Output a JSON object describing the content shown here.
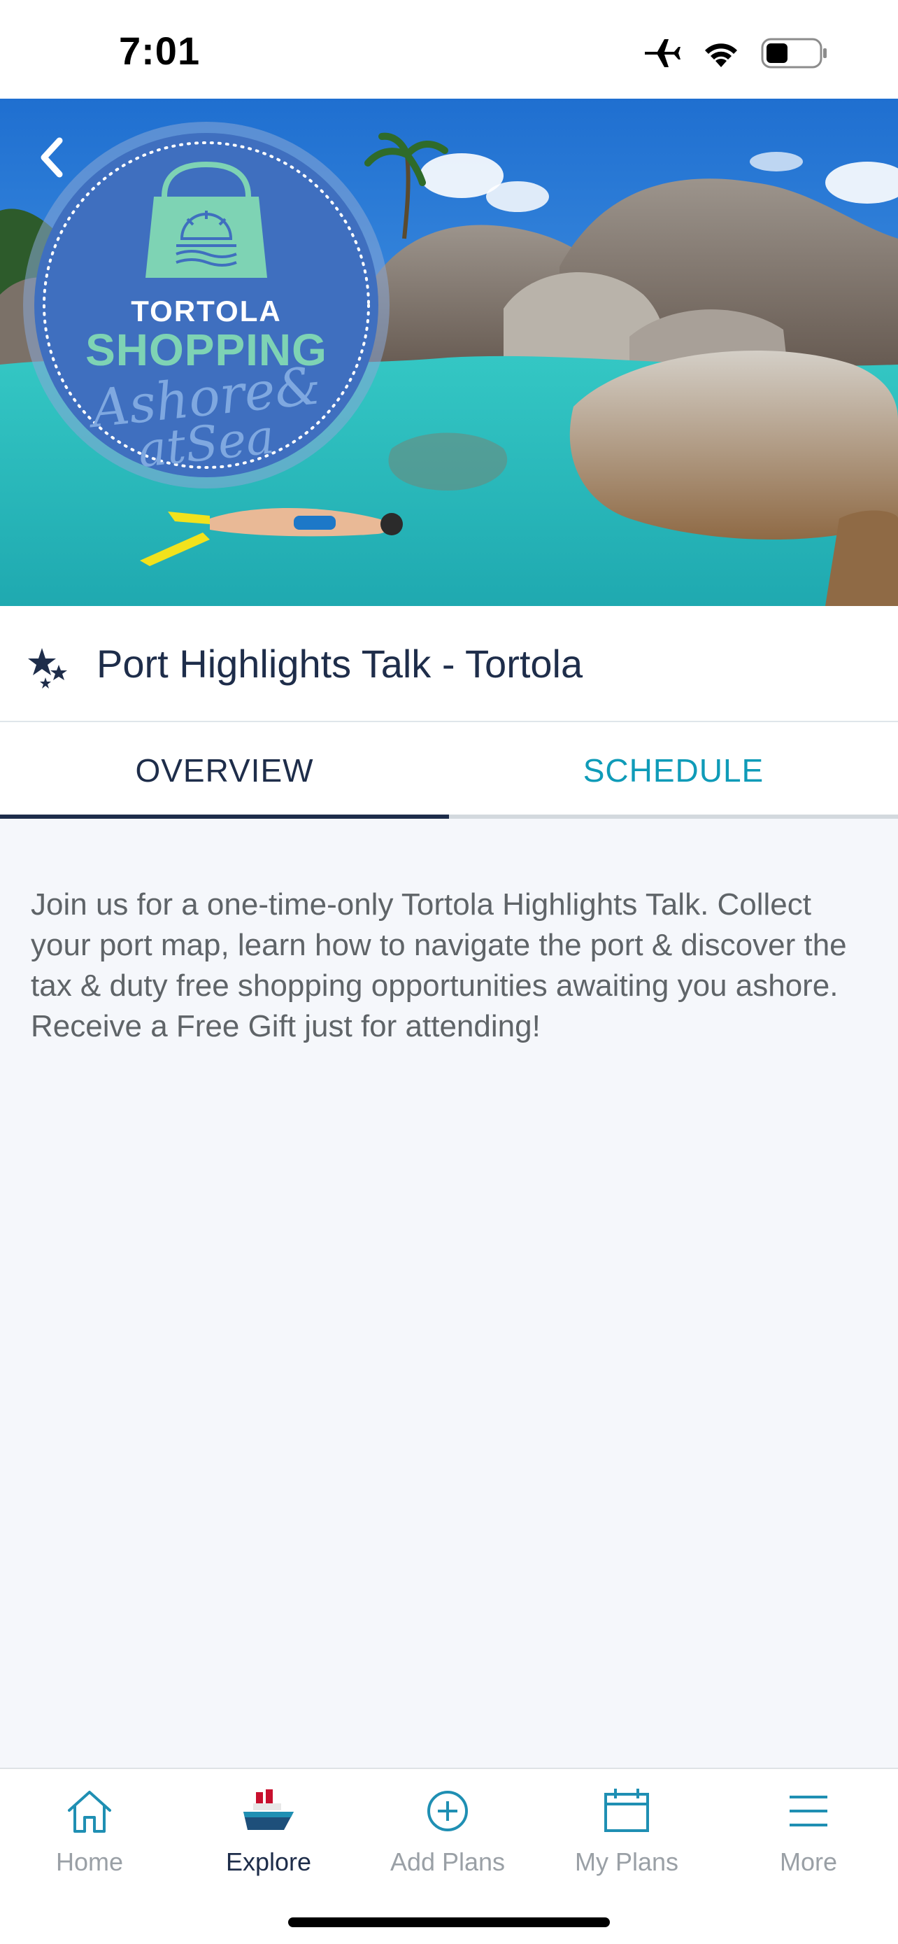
{
  "status_bar": {
    "time": "7:01",
    "icons": [
      "airplane-icon",
      "wifi-icon",
      "battery-icon"
    ]
  },
  "hero": {
    "badge": {
      "line1": "TORTOLA",
      "line2": "SHOPPING",
      "line3": "Ashore&",
      "line4": "atSea"
    },
    "back_icon": "chevron-left-icon"
  },
  "event": {
    "icon": "stars-icon",
    "title": "Port Highlights Talk - Tortola"
  },
  "tabs": [
    {
      "label": "OVERVIEW",
      "active": true
    },
    {
      "label": "SCHEDULE",
      "active": false
    }
  ],
  "overview": {
    "description": "Join us for a one-time-only Tortola Highlights Talk. Collect your port map, learn how to navigate the port & discover the tax & duty free shopping opportunities awaiting you ashore. Receive a Free Gift just for attending!"
  },
  "bottom_nav": [
    {
      "label": "Home",
      "icon": "home-icon",
      "active": false
    },
    {
      "label": "Explore",
      "icon": "ship-icon",
      "active": true
    },
    {
      "label": "Add Plans",
      "icon": "plus-circle-icon",
      "active": false
    },
    {
      "label": "My Plans",
      "icon": "calendar-icon",
      "active": false
    },
    {
      "label": "More",
      "icon": "menu-icon",
      "active": false
    }
  ],
  "colors": {
    "navy": "#1e2d4a",
    "teal_accent": "#0f9bb8",
    "background": "#f5f7fb",
    "badge_blue": "#3f6fbf",
    "badge_green": "#7ed3b4"
  }
}
